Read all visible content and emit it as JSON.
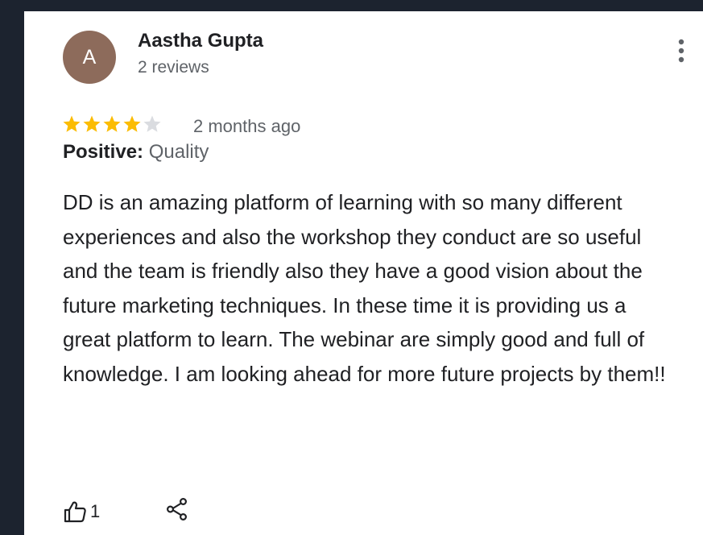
{
  "review": {
    "author": {
      "initial": "A",
      "name": "Aastha Gupta",
      "reviews_count": "2 reviews",
      "avatar_color": "#8d6b5b"
    },
    "rating": 4,
    "rating_max": 5,
    "star_color": "#fbbc04",
    "star_empty_color": "#dadce0",
    "date": "2 months ago",
    "positive_label": "Positive:",
    "positive_value": "Quality",
    "text": "DD is an amazing platform of learning with so many different experiences and also the workshop they conduct are so useful and the team is friendly also they have a good vision about the future marketing techniques. In these time it is providing us a great platform to learn. The webinar are simply good and full of knowledge. I am looking ahead for more future projects by them!!",
    "likes": "1",
    "icons": {
      "more": "more-vert-icon",
      "like": "thumbs-up-icon",
      "share": "share-icon"
    }
  }
}
